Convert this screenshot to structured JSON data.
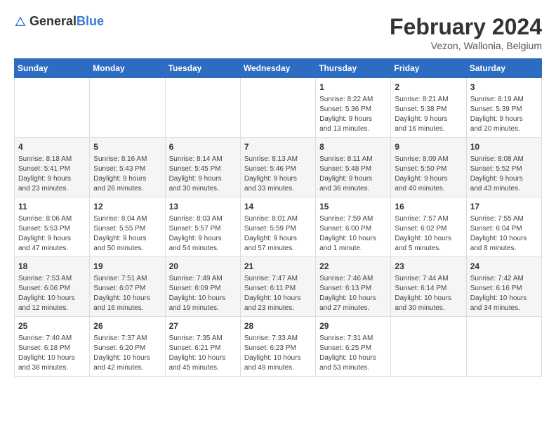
{
  "header": {
    "logo_general": "General",
    "logo_blue": "Blue",
    "title": "February 2024",
    "subtitle": "Vezon, Wallonia, Belgium"
  },
  "days_of_week": [
    "Sunday",
    "Monday",
    "Tuesday",
    "Wednesday",
    "Thursday",
    "Friday",
    "Saturday"
  ],
  "weeks": [
    [
      {
        "day": "",
        "info": ""
      },
      {
        "day": "",
        "info": ""
      },
      {
        "day": "",
        "info": ""
      },
      {
        "day": "",
        "info": ""
      },
      {
        "day": "1",
        "info": "Sunrise: 8:22 AM\nSunset: 5:36 PM\nDaylight: 9 hours\nand 13 minutes."
      },
      {
        "day": "2",
        "info": "Sunrise: 8:21 AM\nSunset: 5:38 PM\nDaylight: 9 hours\nand 16 minutes."
      },
      {
        "day": "3",
        "info": "Sunrise: 8:19 AM\nSunset: 5:39 PM\nDaylight: 9 hours\nand 20 minutes."
      }
    ],
    [
      {
        "day": "4",
        "info": "Sunrise: 8:18 AM\nSunset: 5:41 PM\nDaylight: 9 hours\nand 23 minutes."
      },
      {
        "day": "5",
        "info": "Sunrise: 8:16 AM\nSunset: 5:43 PM\nDaylight: 9 hours\nand 26 minutes."
      },
      {
        "day": "6",
        "info": "Sunrise: 8:14 AM\nSunset: 5:45 PM\nDaylight: 9 hours\nand 30 minutes."
      },
      {
        "day": "7",
        "info": "Sunrise: 8:13 AM\nSunset: 5:46 PM\nDaylight: 9 hours\nand 33 minutes."
      },
      {
        "day": "8",
        "info": "Sunrise: 8:11 AM\nSunset: 5:48 PM\nDaylight: 9 hours\nand 36 minutes."
      },
      {
        "day": "9",
        "info": "Sunrise: 8:09 AM\nSunset: 5:50 PM\nDaylight: 9 hours\nand 40 minutes."
      },
      {
        "day": "10",
        "info": "Sunrise: 8:08 AM\nSunset: 5:52 PM\nDaylight: 9 hours\nand 43 minutes."
      }
    ],
    [
      {
        "day": "11",
        "info": "Sunrise: 8:06 AM\nSunset: 5:53 PM\nDaylight: 9 hours\nand 47 minutes."
      },
      {
        "day": "12",
        "info": "Sunrise: 8:04 AM\nSunset: 5:55 PM\nDaylight: 9 hours\nand 50 minutes."
      },
      {
        "day": "13",
        "info": "Sunrise: 8:03 AM\nSunset: 5:57 PM\nDaylight: 9 hours\nand 54 minutes."
      },
      {
        "day": "14",
        "info": "Sunrise: 8:01 AM\nSunset: 5:59 PM\nDaylight: 9 hours\nand 57 minutes."
      },
      {
        "day": "15",
        "info": "Sunrise: 7:59 AM\nSunset: 6:00 PM\nDaylight: 10 hours\nand 1 minute."
      },
      {
        "day": "16",
        "info": "Sunrise: 7:57 AM\nSunset: 6:02 PM\nDaylight: 10 hours\nand 5 minutes."
      },
      {
        "day": "17",
        "info": "Sunrise: 7:55 AM\nSunset: 6:04 PM\nDaylight: 10 hours\nand 8 minutes."
      }
    ],
    [
      {
        "day": "18",
        "info": "Sunrise: 7:53 AM\nSunset: 6:06 PM\nDaylight: 10 hours\nand 12 minutes."
      },
      {
        "day": "19",
        "info": "Sunrise: 7:51 AM\nSunset: 6:07 PM\nDaylight: 10 hours\nand 16 minutes."
      },
      {
        "day": "20",
        "info": "Sunrise: 7:49 AM\nSunset: 6:09 PM\nDaylight: 10 hours\nand 19 minutes."
      },
      {
        "day": "21",
        "info": "Sunrise: 7:47 AM\nSunset: 6:11 PM\nDaylight: 10 hours\nand 23 minutes."
      },
      {
        "day": "22",
        "info": "Sunrise: 7:46 AM\nSunset: 6:13 PM\nDaylight: 10 hours\nand 27 minutes."
      },
      {
        "day": "23",
        "info": "Sunrise: 7:44 AM\nSunset: 6:14 PM\nDaylight: 10 hours\nand 30 minutes."
      },
      {
        "day": "24",
        "info": "Sunrise: 7:42 AM\nSunset: 6:16 PM\nDaylight: 10 hours\nand 34 minutes."
      }
    ],
    [
      {
        "day": "25",
        "info": "Sunrise: 7:40 AM\nSunset: 6:18 PM\nDaylight: 10 hours\nand 38 minutes."
      },
      {
        "day": "26",
        "info": "Sunrise: 7:37 AM\nSunset: 6:20 PM\nDaylight: 10 hours\nand 42 minutes."
      },
      {
        "day": "27",
        "info": "Sunrise: 7:35 AM\nSunset: 6:21 PM\nDaylight: 10 hours\nand 45 minutes."
      },
      {
        "day": "28",
        "info": "Sunrise: 7:33 AM\nSunset: 6:23 PM\nDaylight: 10 hours\nand 49 minutes."
      },
      {
        "day": "29",
        "info": "Sunrise: 7:31 AM\nSunset: 6:25 PM\nDaylight: 10 hours\nand 53 minutes."
      },
      {
        "day": "",
        "info": ""
      },
      {
        "day": "",
        "info": ""
      }
    ]
  ]
}
